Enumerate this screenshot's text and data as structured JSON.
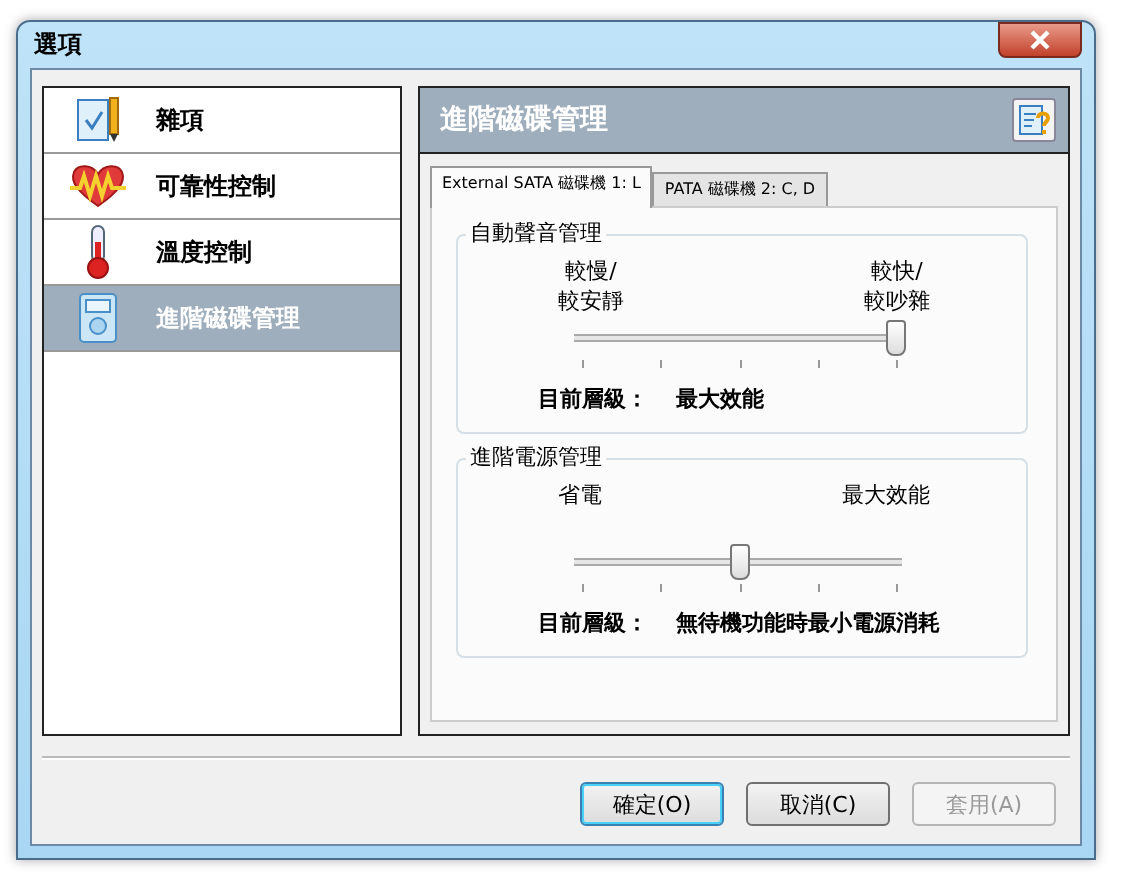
{
  "window": {
    "title": "選項"
  },
  "sidebar": {
    "items": [
      {
        "label": "雜項",
        "selected": false
      },
      {
        "label": "可靠性控制",
        "selected": false
      },
      {
        "label": "溫度控制",
        "selected": false
      },
      {
        "label": "進階磁碟管理",
        "selected": true
      }
    ]
  },
  "panel": {
    "title": "進階磁碟管理",
    "tabs": [
      {
        "label": "External SATA 磁碟機 1: L",
        "selected": true
      },
      {
        "label": "PATA 磁碟機 2: C, D",
        "selected": false
      }
    ],
    "groups": [
      {
        "title": "自動聲音管理",
        "left_label": "較慢/\n較安靜",
        "right_label": "較快/\n較吵雜",
        "level": 1.0,
        "status_label": "目前層級：",
        "status_value": "最大效能"
      },
      {
        "title": "進階電源管理",
        "left_label": "省電",
        "right_label": "最大效能",
        "level": 0.5,
        "status_label": "目前層級：",
        "status_value": "無待機功能時最小電源消耗"
      }
    ]
  },
  "buttons": [
    {
      "label": "確定(O)",
      "default": true,
      "disabled": false
    },
    {
      "label": "取消(C)",
      "default": false,
      "disabled": false
    },
    {
      "label": "套用(A)",
      "default": false,
      "disabled": true
    }
  ]
}
